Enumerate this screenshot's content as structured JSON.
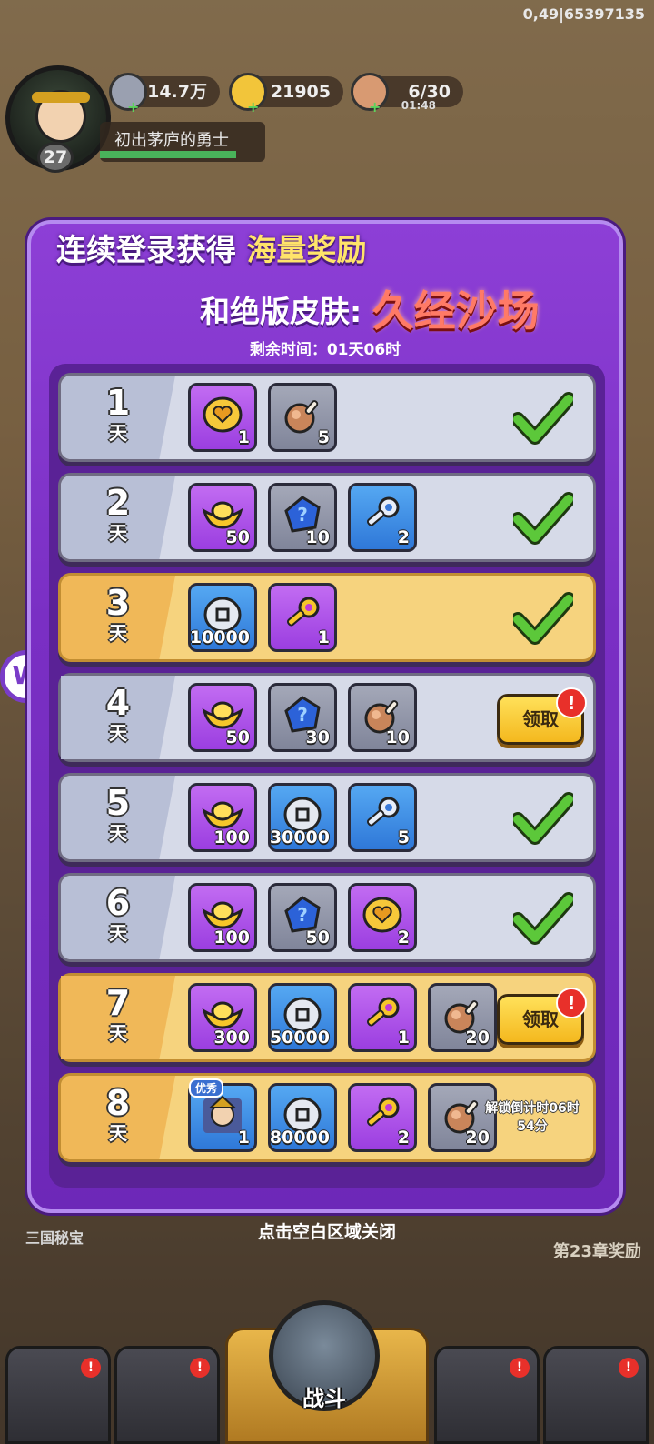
{
  "debug_text": "0,49|65397135",
  "hud": {
    "level": "27",
    "player_title": "初出茅庐的勇士",
    "silver": "14.7万",
    "gold": "21905",
    "stamina": "6/30",
    "stamina_timer": "01:48"
  },
  "panel": {
    "heading_part1": "连续登录获得",
    "heading_highlight": "海量奖励",
    "heading2_prefix": "和绝版皮肤:",
    "skin_name": "久经沙场",
    "countdown": "剩余时间：01天06时"
  },
  "day_unit": "天",
  "claim_label": "领取",
  "claim_badge": "!",
  "days": [
    {
      "num": "1",
      "style": "silver",
      "status": "claimed",
      "items": [
        {
          "icon": "heart-coin-icon",
          "bg": "purple",
          "qty": "1"
        },
        {
          "icon": "meat-icon",
          "bg": "gray",
          "qty": "5"
        }
      ]
    },
    {
      "num": "2",
      "style": "silver",
      "status": "claimed",
      "items": [
        {
          "icon": "gold-ingot-icon",
          "bg": "purple",
          "qty": "50"
        },
        {
          "icon": "mystery-gem-icon",
          "bg": "gray",
          "qty": "10"
        },
        {
          "icon": "silver-key-icon",
          "bg": "blue",
          "qty": "2"
        }
      ]
    },
    {
      "num": "3",
      "style": "gold",
      "status": "claimed",
      "items": [
        {
          "icon": "silver-coin-icon",
          "bg": "blue",
          "qty": "10000"
        },
        {
          "icon": "gold-key-icon",
          "bg": "purple",
          "qty": "1"
        }
      ]
    },
    {
      "num": "4",
      "style": "silver",
      "status": "claimable",
      "items": [
        {
          "icon": "gold-ingot-icon",
          "bg": "purple",
          "qty": "50"
        },
        {
          "icon": "mystery-gem-icon",
          "bg": "gray",
          "qty": "30"
        },
        {
          "icon": "meat-icon",
          "bg": "gray",
          "qty": "10"
        }
      ]
    },
    {
      "num": "5",
      "style": "silver",
      "status": "claimed",
      "items": [
        {
          "icon": "gold-ingot-icon",
          "bg": "purple",
          "qty": "100"
        },
        {
          "icon": "silver-coin-icon",
          "bg": "blue",
          "qty": "30000"
        },
        {
          "icon": "silver-key-icon",
          "bg": "blue",
          "qty": "5"
        }
      ]
    },
    {
      "num": "6",
      "style": "silver",
      "status": "claimed",
      "items": [
        {
          "icon": "gold-ingot-icon",
          "bg": "purple",
          "qty": "100"
        },
        {
          "icon": "mystery-gem-icon",
          "bg": "gray",
          "qty": "50"
        },
        {
          "icon": "heart-coin-icon",
          "bg": "purple",
          "qty": "2"
        }
      ]
    },
    {
      "num": "7",
      "style": "gold",
      "status": "claimable",
      "items": [
        {
          "icon": "gold-ingot-icon",
          "bg": "purple",
          "qty": "300"
        },
        {
          "icon": "silver-coin-icon",
          "bg": "blue",
          "qty": "50000"
        },
        {
          "icon": "gold-key-icon",
          "bg": "purple",
          "qty": "1"
        },
        {
          "icon": "meat-icon",
          "bg": "gray",
          "qty": "20"
        }
      ]
    },
    {
      "num": "8",
      "style": "gold",
      "status": "locked",
      "unlock_text": "解锁倒计时06时54分",
      "items": [
        {
          "icon": "hero-portrait-icon",
          "bg": "blue",
          "qty": "1",
          "tag": "优秀"
        },
        {
          "icon": "silver-coin-icon",
          "bg": "blue",
          "qty": "80000"
        },
        {
          "icon": "gold-key-icon",
          "bg": "purple",
          "qty": "2"
        },
        {
          "icon": "meat-icon",
          "bg": "gray",
          "qty": "20"
        }
      ]
    }
  ],
  "close_hint": "点击空白区域关闭",
  "bg_left_text": "三国秘宝",
  "bg_right_text": "第23章奖励",
  "battle_label": "战斗",
  "colors": {
    "panel": "#7a2fc4",
    "gold_row": "#f6d37e",
    "silver_row": "#d6dae8",
    "check": "#5cc83a",
    "claim": "#f4b81e"
  }
}
